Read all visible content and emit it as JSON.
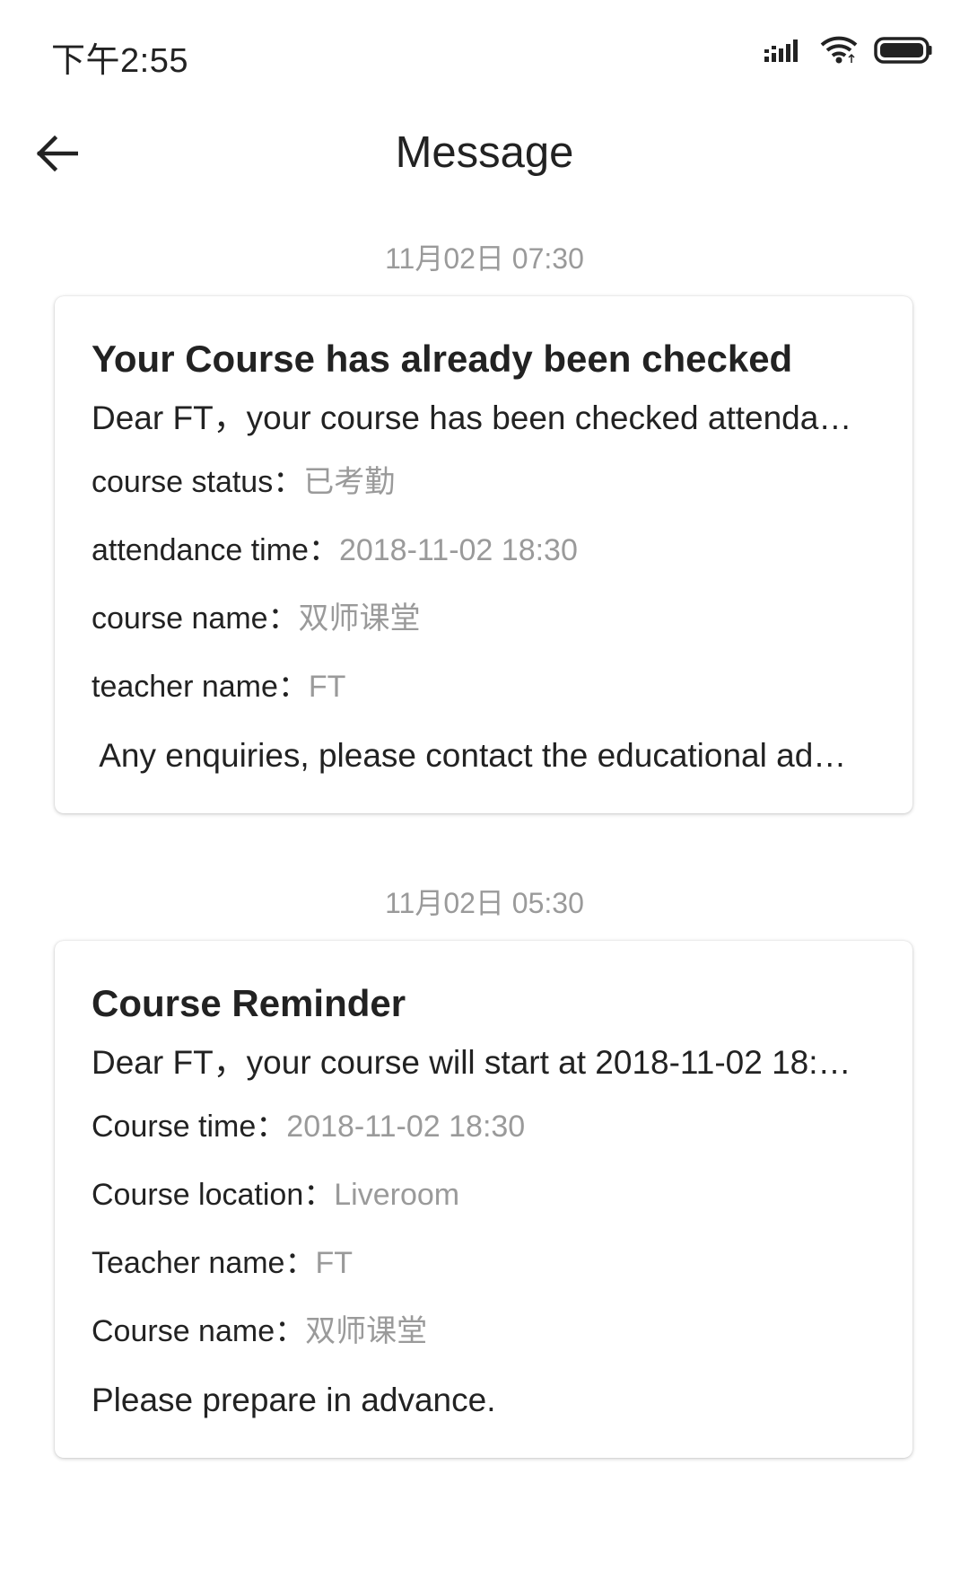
{
  "status_bar": {
    "time": "下午2:55",
    "icons": [
      "signal-icon",
      "wifi-icon",
      "battery-icon"
    ]
  },
  "header": {
    "title": "Message",
    "back_icon": "arrow-left-icon"
  },
  "messages": [
    {
      "time": "11月02日 07:30",
      "title": "Your Course has already been checked",
      "summary": "Dear FT，your course has been checked attenda…",
      "fields": [
        {
          "label": "course status：",
          "value": "已考勤"
        },
        {
          "label": "attendance time：",
          "value": "2018-11-02 18:30"
        },
        {
          "label": "course name：",
          "value": "双师课堂"
        },
        {
          "label": "teacher name：",
          "value": "FT"
        }
      ],
      "footer": " Any enquiries, please contact the educational ad…"
    },
    {
      "time": "11月02日 05:30",
      "title": "Course Reminder",
      "summary": "Dear FT，your course will start at 2018-11-02 18:…",
      "fields": [
        {
          "label": "Course time：",
          "value": "2018-11-02 18:30"
        },
        {
          "label": "Course location：",
          "value": "Liveroom"
        },
        {
          "label": "Teacher name：",
          "value": "FT"
        },
        {
          "label": "Course name：",
          "value": "双师课堂"
        }
      ],
      "footer": "Please prepare in advance."
    }
  ]
}
